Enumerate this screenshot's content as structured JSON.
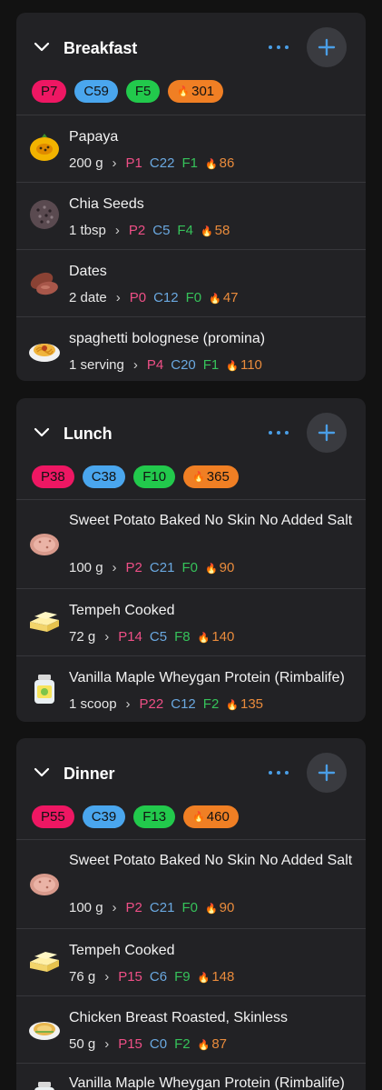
{
  "meals": [
    {
      "title": "Breakfast",
      "totals": {
        "p": "P7",
        "c": "C59",
        "f": "F5",
        "kcal": "301"
      },
      "items": [
        {
          "name": "Papaya",
          "amount": "200 g",
          "p": "P1",
          "c": "C22",
          "f": "F1",
          "kcal": "86",
          "icon": "papaya-icon"
        },
        {
          "name": "Chia Seeds",
          "amount": "1 tbsp",
          "p": "P2",
          "c": "C5",
          "f": "F4",
          "kcal": "58",
          "icon": "chia-seeds-icon"
        },
        {
          "name": "Dates",
          "amount": "2 date",
          "p": "P0",
          "c": "C12",
          "f": "F0",
          "kcal": "47",
          "icon": "dates-icon"
        },
        {
          "name": "spaghetti bolognese (promina)",
          "amount": "1 serving",
          "p": "P4",
          "c": "C20",
          "f": "F1",
          "kcal": "110",
          "icon": "spaghetti-icon"
        }
      ]
    },
    {
      "title": "Lunch",
      "totals": {
        "p": "P38",
        "c": "C38",
        "f": "F10",
        "kcal": "365"
      },
      "items": [
        {
          "name": "Sweet Potato Baked No Skin No Added Salt",
          "amount": "100 g",
          "p": "P2",
          "c": "C21",
          "f": "F0",
          "kcal": "90",
          "icon": "sweet-potato-icon"
        },
        {
          "name": "Tempeh Cooked",
          "amount": "72 g",
          "p": "P14",
          "c": "C5",
          "f": "F8",
          "kcal": "140",
          "icon": "tempeh-icon"
        },
        {
          "name": "Vanilla Maple Wheygan Protein (Rimbalife)",
          "amount": "1 scoop",
          "p": "P22",
          "c": "C12",
          "f": "F2",
          "kcal": "135",
          "icon": "protein-jar-icon"
        }
      ]
    },
    {
      "title": "Dinner",
      "totals": {
        "p": "P55",
        "c": "C39",
        "f": "F13",
        "kcal": "460"
      },
      "items": [
        {
          "name": "Sweet Potato Baked No Skin No Added Salt",
          "amount": "100 g",
          "p": "P2",
          "c": "C21",
          "f": "F0",
          "kcal": "90",
          "icon": "sweet-potato-icon"
        },
        {
          "name": "Tempeh Cooked",
          "amount": "76 g",
          "p": "P15",
          "c": "C6",
          "f": "F9",
          "kcal": "148",
          "icon": "tempeh-icon"
        },
        {
          "name": "Chicken Breast Roasted, Skinless",
          "amount": "50 g",
          "p": "P15",
          "c": "C0",
          "f": "F2",
          "kcal": "87",
          "icon": "chicken-breast-icon"
        },
        {
          "name": "Vanilla Maple Wheygan Protein (Rimbalife)",
          "amount": "",
          "p": "",
          "c": "",
          "f": "",
          "kcal": "",
          "icon": "protein-jar-icon"
        }
      ]
    }
  ],
  "separator": "›",
  "colors": {
    "protein": "#ee1763",
    "carbs": "#4aa6ee",
    "fat": "#22c94c",
    "kcal": "#f07f24",
    "accent": "#4a9ee6",
    "card": "#222225",
    "background": "#121212"
  }
}
